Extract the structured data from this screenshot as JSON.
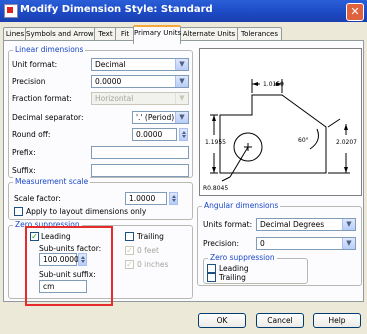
{
  "window": {
    "title": "Modify Dimension Style: Standard",
    "close_glyph": "✕"
  },
  "tabs": [
    "Lines",
    "Symbols and Arrows",
    "Text",
    "Fit",
    "Primary Units",
    "Alternate Units",
    "Tolerances"
  ],
  "linear": {
    "title": "Linear dimensions",
    "unit_format_label": "Unit format:",
    "unit_format_value": "Decimal",
    "precision_label": "Precision",
    "precision_value": "0.0000",
    "fraction_label": "Fraction format:",
    "fraction_value": "Horizontal",
    "decimal_sep_label": "Decimal separator:",
    "decimal_sep_value": "'.' (Period)",
    "round_off_label": "Round off:",
    "round_off_value": "0.0000",
    "prefix_label": "Prefix:",
    "prefix_value": "",
    "suffix_label": "Suffix:",
    "suffix_value": ""
  },
  "measurement": {
    "title": "Measurement scale",
    "scale_label": "Scale factor:",
    "scale_value": "1.0000",
    "layout_only_label": "Apply to layout dimensions only"
  },
  "zero_suppression": {
    "title": "Zero suppression",
    "leading_label": "Leading",
    "leading_checked": true,
    "trailing_label": "Trailing",
    "trailing_checked": false,
    "sub_units_factor_label": "Sub-units factor:",
    "sub_units_factor_value": "100.0000",
    "sub_unit_suffix_label": "Sub-unit suffix:",
    "sub_unit_suffix_value": "cm",
    "zero_feet_label": "0 feet",
    "zero_inches_label": "0 inches"
  },
  "preview": {
    "dim_top": "1.0159",
    "dim_left": "1.1955",
    "dim_right": "2.0207",
    "angle": "60°",
    "radius": "R0.8045",
    "angle_glyph": "∠",
    "radius_glyph": "Ø"
  },
  "angular": {
    "title": "Angular dimensions",
    "units_format_label": "Units format:",
    "units_format_value": "Decimal Degrees",
    "precision_label": "Precision:",
    "precision_value": "0",
    "zs_title": "Zero suppression",
    "leading_label": "Leading",
    "trailing_label": "Trailing"
  },
  "buttons": {
    "ok": "OK",
    "cancel": "Cancel",
    "help": "Help"
  },
  "icons": {
    "dropdown": "▼",
    "check": "✓"
  }
}
